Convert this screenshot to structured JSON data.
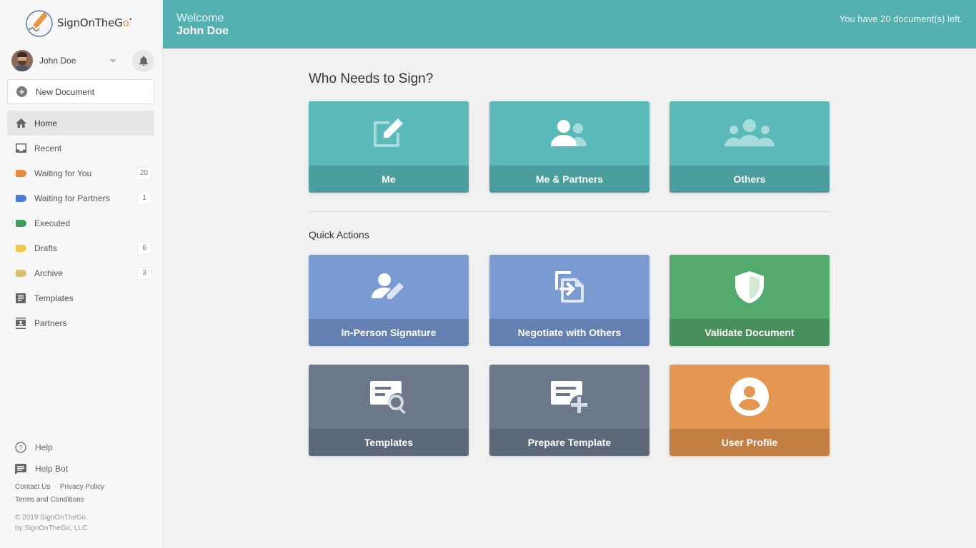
{
  "app": {
    "logo_text_main": "SignOnTheG",
    "logo_text_accent": "o",
    "logo_suffix": "•"
  },
  "user": {
    "name": "John Doe"
  },
  "sidebar": {
    "new_document": "New Document",
    "items": [
      {
        "label": "Home",
        "icon": "home-icon",
        "active": true,
        "count": ""
      },
      {
        "label": "Recent",
        "icon": "inbox-icon",
        "count": ""
      },
      {
        "label": "Waiting for You",
        "icon": "tag-icon",
        "color": "#e8893c",
        "count": "20"
      },
      {
        "label": "Waiting for Partners",
        "icon": "tag-icon",
        "color": "#4a7ad8",
        "count": "1"
      },
      {
        "label": "Executed",
        "icon": "tag-icon",
        "color": "#3f9e5b",
        "count": ""
      },
      {
        "label": "Drafts",
        "icon": "tag-icon",
        "color": "#f0c94a",
        "count": "6"
      },
      {
        "label": "Archive",
        "icon": "tag-icon",
        "color": "#d5bf6e",
        "count": "3"
      },
      {
        "label": "Templates",
        "icon": "document-icon",
        "count": ""
      },
      {
        "label": "Partners",
        "icon": "contacts-icon",
        "count": ""
      }
    ],
    "footer": {
      "help": "Help",
      "help_bot": "Help Bot",
      "contact": "Contact Us",
      "privacy": "Privacy Policy",
      "terms": "Terms and Conditions",
      "copyright": "© 2019 SignOnTheGo.",
      "company": "by SignOnTheGo, LLC"
    }
  },
  "header": {
    "welcome": "Welcome",
    "name": "John Doe",
    "docs_left": "You have 20 document(s) left."
  },
  "main": {
    "who_title": "Who Needs to Sign?",
    "who_cards": [
      {
        "label": "Me",
        "icon": "edit-icon",
        "color": "#5cb9ba"
      },
      {
        "label": "Me & Partners",
        "icon": "people-icon",
        "color": "#5cb9ba"
      },
      {
        "label": "Others",
        "icon": "group-icon",
        "color": "#5cb9ba"
      }
    ],
    "quick_title": "Quick Actions",
    "quick_cards": [
      {
        "label": "In-Person Signature",
        "icon": "person-edit-icon",
        "color": "#7a9bd2"
      },
      {
        "label": "Negotiate with Others",
        "icon": "negotiate-icon",
        "color": "#7a9bd2"
      },
      {
        "label": "Validate Document",
        "icon": "shield-icon",
        "color": "#54a96c"
      },
      {
        "label": "Templates",
        "icon": "template-search-icon",
        "color": "#6c788a"
      },
      {
        "label": "Prepare Template",
        "icon": "template-add-icon",
        "color": "#6c788a"
      },
      {
        "label": "User Profile",
        "icon": "user-profile-icon",
        "color": "#e39750"
      }
    ]
  }
}
